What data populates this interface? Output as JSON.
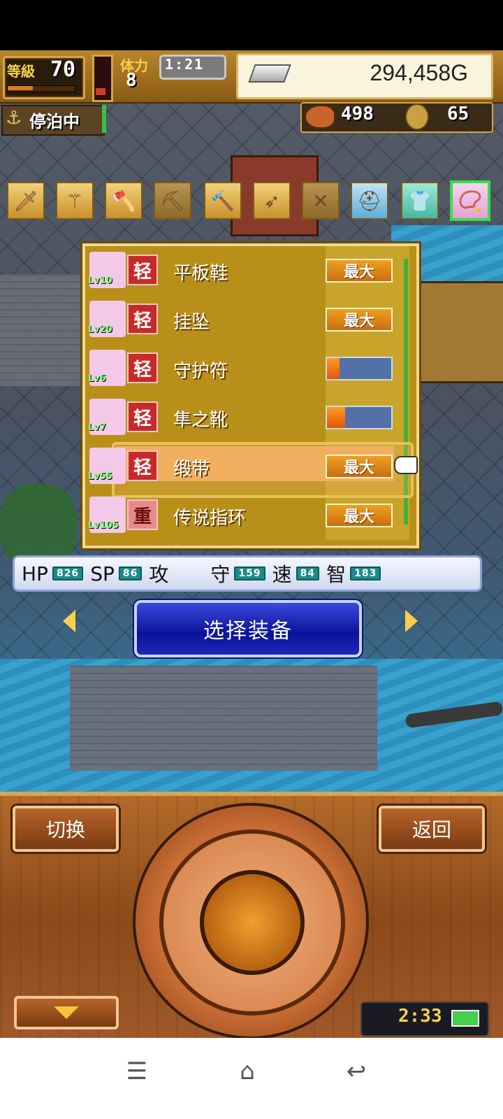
{
  "hud": {
    "level_label": "等級",
    "level_value": "70",
    "stamina_label": "体力",
    "stamina_value": "8",
    "clock": "1:21",
    "gold": "294,458G",
    "status_label": "停泊中",
    "food_value": "498",
    "coin_value": "65"
  },
  "categories": [
    {
      "name": "sword-icon",
      "glyph": "🗡"
    },
    {
      "name": "staff-icon",
      "glyph": "⚚"
    },
    {
      "name": "axe-icon",
      "glyph": "🪓"
    },
    {
      "name": "pickaxe-icon",
      "glyph": "⛏"
    },
    {
      "name": "hammer-icon",
      "glyph": "🔨"
    },
    {
      "name": "bow-icon",
      "glyph": "➶"
    },
    {
      "name": "crossbow-icon",
      "glyph": "✕"
    },
    {
      "name": "helmet-icon",
      "glyph": "⛑"
    },
    {
      "name": "armor-icon",
      "glyph": "👕"
    },
    {
      "name": "accessory-icon",
      "glyph": "📿"
    }
  ],
  "items": [
    {
      "lv": "Lv10",
      "weight": "轻",
      "name": "平板鞋",
      "status": "最大",
      "icon": "shoe-icon",
      "icon_color": "#f4c8e8"
    },
    {
      "lv": "Lv20",
      "weight": "轻",
      "name": "挂坠",
      "status": "最大",
      "icon": "pendant-icon",
      "icon_color": "#f4c8e8"
    },
    {
      "lv": "Lv6",
      "weight": "轻",
      "name": "守护符",
      "progress": 0.2,
      "icon": "charm-icon",
      "icon_color": "#f4c8e8"
    },
    {
      "lv": "Lv7",
      "weight": "轻",
      "name": "隼之靴",
      "progress": 0.28,
      "icon": "boots-icon",
      "icon_color": "#f4c8e8"
    },
    {
      "lv": "Lv55",
      "weight": "轻",
      "name": "缎带",
      "status": "最大",
      "icon": "ribbon-icon",
      "icon_color": "#f4c8e8"
    },
    {
      "lv": "Lv105",
      "weight": "重",
      "name": "传说指环",
      "status": "最大",
      "icon": "ring-icon",
      "icon_color": "#f4c8e8"
    }
  ],
  "stats": {
    "hp_label": "HP",
    "hp_value": "826",
    "sp_label": "SP",
    "sp_value": "86",
    "atk_label": "攻",
    "def_label": "守",
    "def_value": "159",
    "spd_label": "速",
    "spd_value": "84",
    "int_label": "智",
    "int_value": "183"
  },
  "select_button": "选择装备",
  "controls": {
    "switch_label": "切换",
    "back_label": "返回",
    "game_time": "2:33"
  }
}
